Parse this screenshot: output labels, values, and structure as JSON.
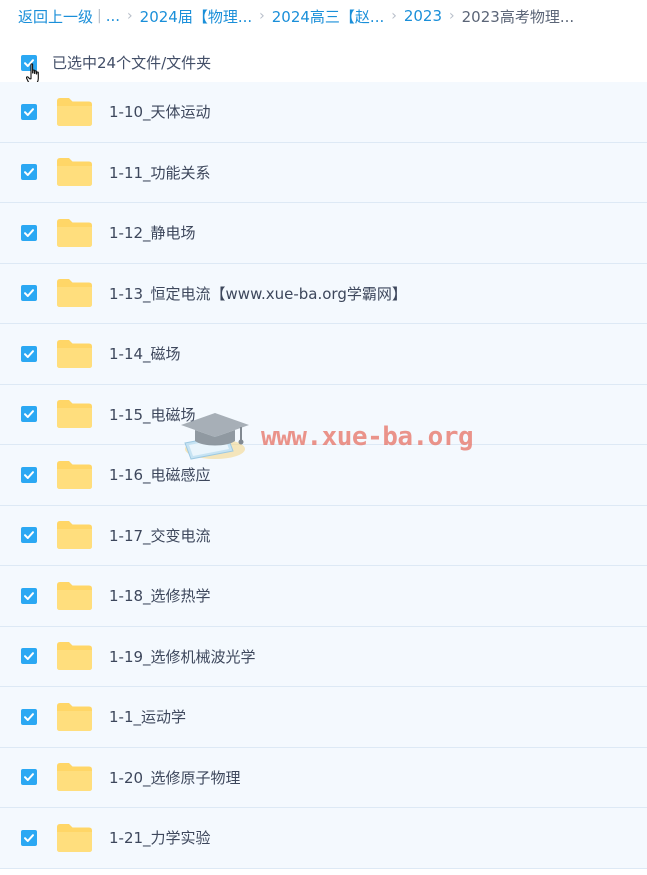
{
  "breadcrumb": {
    "back": "返回上一级",
    "divider": "|",
    "ellipsis": "...",
    "items": [
      "2024届【物理...",
      "2024高三【赵...",
      "2023"
    ],
    "current": "2023高考物理..."
  },
  "selection": {
    "label": "已选中24个文件/文件夹"
  },
  "files": [
    {
      "name": "1-10_天体运动"
    },
    {
      "name": "1-11_功能关系"
    },
    {
      "name": "1-12_静电场"
    },
    {
      "name": "1-13_恒定电流【www.xue-ba.org学霸网】"
    },
    {
      "name": "1-14_磁场"
    },
    {
      "name": "1-15_电磁场"
    },
    {
      "name": "1-16_电磁感应"
    },
    {
      "name": "1-17_交变电流"
    },
    {
      "name": "1-18_选修热学"
    },
    {
      "name": "1-19_选修机械波光学"
    },
    {
      "name": "1-1_运动学"
    },
    {
      "name": "1-20_选修原子物理"
    },
    {
      "name": "1-21_力学实验"
    }
  ],
  "watermark": {
    "text": "www.xue-ba.org"
  },
  "colors": {
    "accent": "#1a8fd9",
    "checkbox": "#2ba8f3",
    "folder": "#ffd667",
    "row_bg": "#f4f9fe",
    "watermark": "#e87a6e"
  },
  "icons": {
    "checkbox": "check-icon",
    "folder": "folder-icon",
    "cursor": "hand-pointer-icon",
    "watermark": "graduation-cap-icon"
  }
}
